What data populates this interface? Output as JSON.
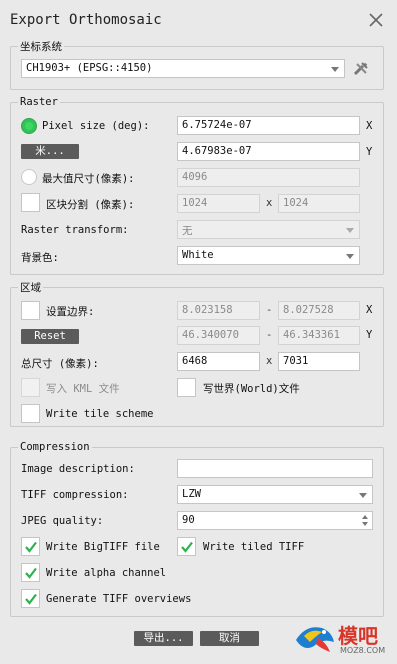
{
  "window": {
    "title": "Export Orthomosaic"
  },
  "crs_group": {
    "title": "坐标系统",
    "value": "CH1903+ (EPSG::4150)"
  },
  "raster": {
    "title": "Raster",
    "pixel_size_label": "Pixel size (deg):",
    "pixel_x": "6.75724e-07",
    "pixel_y": "4.67983e-07",
    "axis_x": "X",
    "axis_y": "Y",
    "meter_button": "米...",
    "max_size_label": "最大值尺寸(像素):",
    "max_size_value": "4096",
    "block_split_label": "区块分割 (像素):",
    "block_w": "1024",
    "block_h": "1024",
    "times": "x",
    "transform_label": "Raster transform:",
    "transform_value": "无",
    "bg_label": "背景色:",
    "bg_value": "White"
  },
  "region": {
    "title": "区域",
    "bounds_label": "设置边界:",
    "xmin": "8.023158",
    "xmax": "8.027528",
    "ymin": "46.340070",
    "ymax": "46.343361",
    "dash": "-",
    "axis_x": "X",
    "axis_y": "Y",
    "reset_button": "Reset",
    "total_size_label": "总尺寸 (像素):",
    "total_w": "6468",
    "total_h": "7031",
    "times": "x",
    "kml_label": "写入 KML 文件",
    "world_label": "写世界(World)文件",
    "tile_label": "Write tile scheme"
  },
  "compression": {
    "title": "Compression",
    "desc_label": "Image description:",
    "desc_value": "",
    "tiff_label": "TIFF compression:",
    "tiff_value": "LZW",
    "jpeg_label": "JPEG quality:",
    "jpeg_value": "90",
    "bigtiff_label": "Write BigTIFF file",
    "tiled_label": "Write tiled TIFF",
    "alpha_label": "Write alpha channel",
    "overviews_label": "Generate TIFF overviews"
  },
  "footer": {
    "export_button": "导出...",
    "cancel_button": "取消"
  },
  "watermark": {
    "text": "模吧",
    "sub": "MOZ8.COM"
  },
  "colors": {
    "accent_green": "#3bd964",
    "button_grey": "#5b5b5b",
    "background": "#e9e9e9"
  }
}
